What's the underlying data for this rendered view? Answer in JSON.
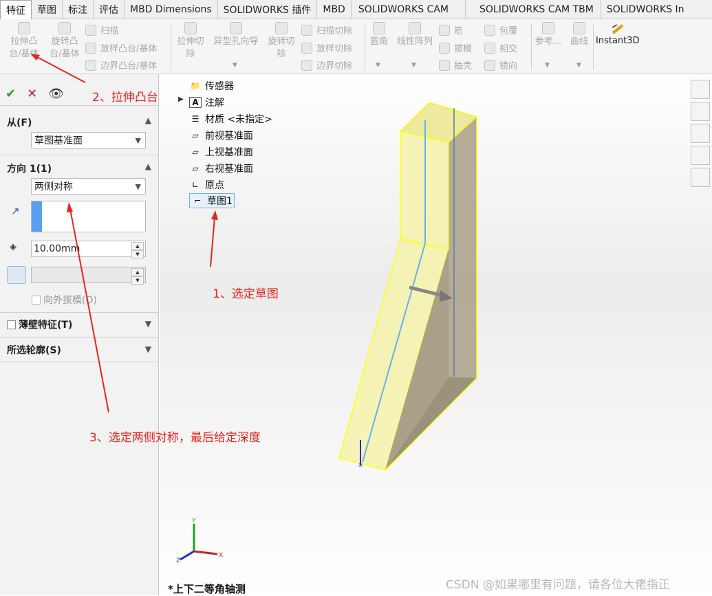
{
  "tabs": [
    {
      "label": "特征",
      "active": true
    },
    {
      "label": "草图"
    },
    {
      "label": "标注"
    },
    {
      "label": "评估"
    },
    {
      "label": "MBD Dimensions"
    },
    {
      "label": "SOLIDWORKS 插件"
    },
    {
      "label": "MBD"
    },
    {
      "label": "SOLIDWORKS CAM"
    },
    {
      "label": "SOLIDWORKS CAM TBM"
    },
    {
      "label": "SOLIDWORKS In"
    }
  ],
  "ribbon": {
    "extrude_boss": "拉伸凸\n台/基体",
    "revolve_boss": "旋转凸\n台/基体",
    "sweep": "扫描",
    "loft_boss": "放样凸台/基体",
    "boundary_boss": "边界凸台/基体",
    "extrude_cut": "拉伸切\n除",
    "hole_wizard": "异型孔向导",
    "revolve_cut": "旋转切\n除",
    "sweep_cut": "扫描切除",
    "loft_cut": "放样切除",
    "boundary_cut": "边界切除",
    "fillet": "圆角",
    "linear_pattern": "线性阵列",
    "rib": "筋",
    "draft": "拔模",
    "shell": "抽壳",
    "wrap": "包覆",
    "intersect": "相交",
    "mirror": "镜向",
    "reference": "参考...",
    "curves": "曲线",
    "instant3d": "Instant3D"
  },
  "panel": {
    "from_title": "从(F)",
    "from_value": "草图基准面",
    "direction_title": "方向 1(1)",
    "direction_value": "两侧对称",
    "depth_value": "10.00mm",
    "draft_outward": "向外拔模(O)",
    "thin_feature": "薄壁特征(T)",
    "selected_contours": "所选轮廓(S)"
  },
  "tree": [
    {
      "label": "传感器"
    },
    {
      "label": "注解"
    },
    {
      "label": "材质 <未指定>"
    },
    {
      "label": "前视基准面"
    },
    {
      "label": "上视基准面"
    },
    {
      "label": "右视基准面"
    },
    {
      "label": "原点"
    },
    {
      "label": "草图1"
    }
  ],
  "annotations": {
    "step1": "1、选定草图",
    "step2": "2、拉伸凸台",
    "step3": "3、选定两侧对称，最后给定深度"
  },
  "view_label": "*上下二等角轴测",
  "watermark": "CSDN @如果哪里有问题，请各位大佬指正",
  "colors": {
    "annotation": "#e8241c",
    "part_fill": "#f3f0a0",
    "part_edge": "#ffff00",
    "selection": "#5aa0f0"
  }
}
